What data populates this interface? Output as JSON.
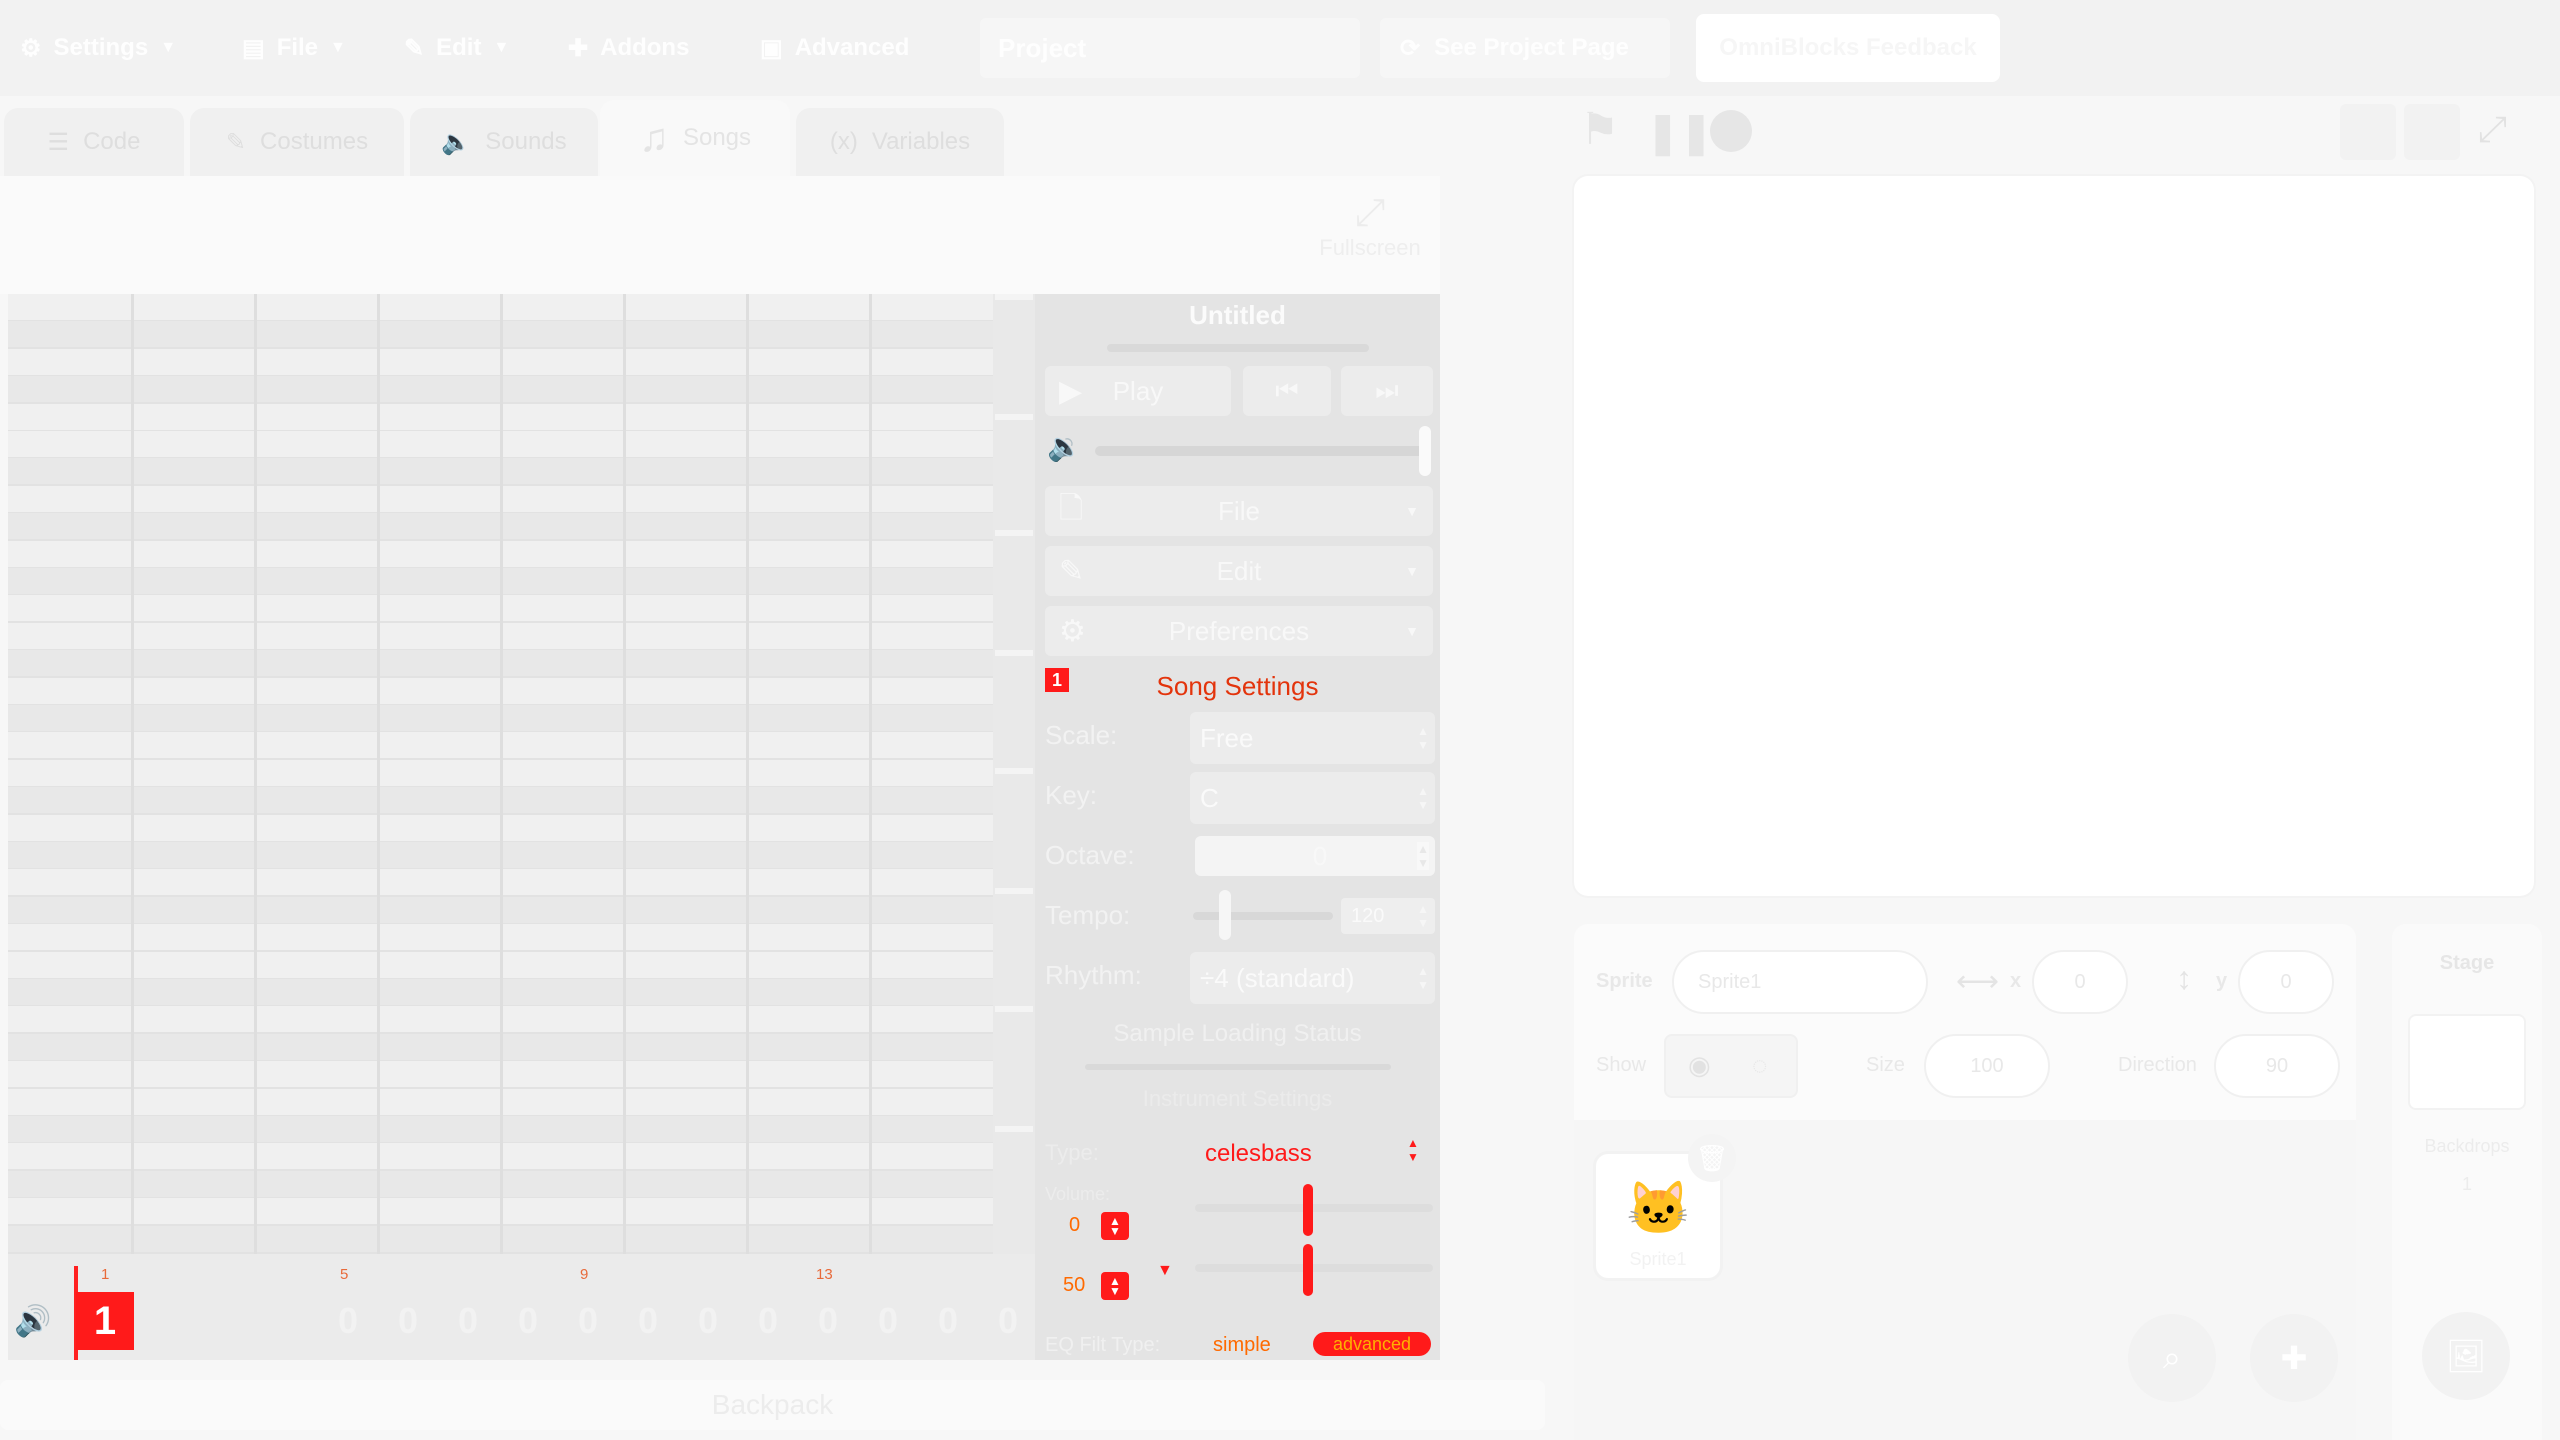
{
  "menu": {
    "settings": "Settings",
    "file": "File",
    "edit": "Edit",
    "addons": "Addons",
    "advanced": "Advanced",
    "project_title": "Project",
    "see_project_page": "See Project Page",
    "feedback": "OmniBlocks Feedback"
  },
  "tabs": [
    {
      "label": "Code",
      "icon": "code-icon"
    },
    {
      "label": "Costumes",
      "icon": "brush-icon"
    },
    {
      "label": "Sounds",
      "icon": "speaker-icon"
    },
    {
      "label": "Songs",
      "icon": "music-note-icon",
      "active": true
    },
    {
      "label": "Variables",
      "icon": "variable-icon"
    }
  ],
  "editor": {
    "fullscreen_label": "Fullscreen"
  },
  "timeline": {
    "bar_numbers": [
      "1",
      "5",
      "9",
      "13"
    ],
    "current_pattern": "1",
    "step_value": "0"
  },
  "song_panel": {
    "title": "Untitled",
    "play": "Play",
    "file": "File",
    "edit": "Edit",
    "preferences": "Preferences",
    "song_settings": "Song Settings",
    "song_settings_badge": "1",
    "scale_label": "Scale:",
    "scale_value": "Free",
    "key_label": "Key:",
    "key_value": "C",
    "octave_label": "Octave:",
    "octave_value": "0",
    "tempo_label": "Tempo:",
    "tempo_value": "120",
    "rhythm_label": "Rhythm:",
    "rhythm_value": "÷4 (standard)",
    "sample_loading": "Sample Loading Status",
    "instrument_settings": "Instrument Settings",
    "type_label": "Type:",
    "type_value": "celesbass",
    "volume_label": "Volume:",
    "volume_value": "0",
    "pan_value": "50",
    "eq_label": "EQ Filt Type:",
    "mode_simple": "simple",
    "mode_advanced": "advanced"
  },
  "backpack": "Backpack",
  "sprite_info": {
    "sprite_label": "Sprite",
    "sprite_name": "Sprite1",
    "x_label": "x",
    "x_value": "0",
    "y_label": "y",
    "y_value": "0",
    "show_label": "Show",
    "size_label": "Size",
    "size_value": "100",
    "direction_label": "Direction",
    "direction_value": "90",
    "sprite_thumb_name": "Sprite1"
  },
  "stage_pane": {
    "stage_label": "Stage",
    "backdrops_label": "Backdrops",
    "backdrops_count": "1"
  },
  "colors": {
    "accent_red": "#ff1a1a",
    "accent_orange": "#e3340c"
  }
}
